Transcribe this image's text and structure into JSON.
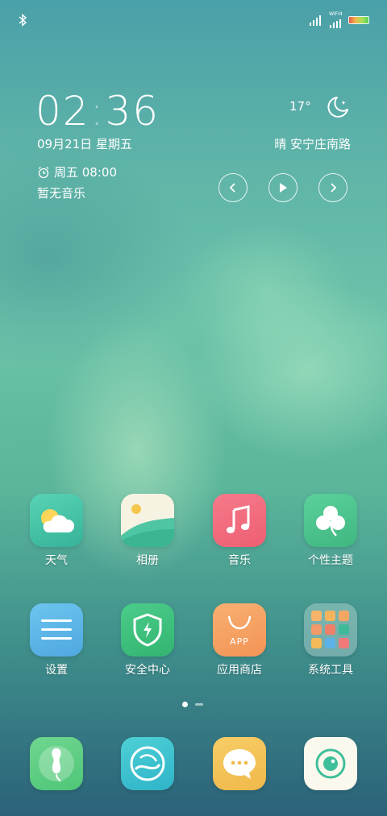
{
  "status_bar": {
    "icons": [
      "bluetooth-icon",
      "signal-icon",
      "wifi-icon",
      "battery-icon"
    ],
    "wifi_label": "WIFI4"
  },
  "clock": {
    "hour": "02",
    "separator": ":",
    "minute": "36"
  },
  "date_text": "09月21日  星期五",
  "alarm_text": "周五 08:00",
  "music_text": "暂无音乐",
  "weather": {
    "temperature": "17°",
    "condition_location": "晴 安宁庄南路",
    "icon": "moon-icon"
  },
  "media_controls": {
    "icons": [
      "prev-icon",
      "play-icon",
      "next-icon"
    ]
  },
  "apps_row1": [
    {
      "label": "天气",
      "icon": "weather-app-icon"
    },
    {
      "label": "相册",
      "icon": "gallery-app-icon"
    },
    {
      "label": "音乐",
      "icon": "music-app-icon"
    },
    {
      "label": "个性主题",
      "icon": "themes-app-icon"
    }
  ],
  "apps_row2": [
    {
      "label": "设置",
      "icon": "settings-app-icon"
    },
    {
      "label": "安全中心",
      "icon": "security-app-icon"
    },
    {
      "label": "应用商店",
      "icon": "app-store-icon"
    },
    {
      "label": "系统工具",
      "icon": "system-tools-folder-icon"
    }
  ],
  "app_store_icon_text": "APP",
  "page_indicator": {
    "pages": 2,
    "active": 1
  },
  "dock": [
    {
      "icon": "phone-app-icon"
    },
    {
      "icon": "browser-app-icon"
    },
    {
      "icon": "messages-app-icon"
    },
    {
      "icon": "camera-app-icon"
    }
  ],
  "colors": {
    "weather": "#4fc9a9",
    "gallery": "#f7f3e3",
    "music": "#f2677a",
    "themes": "#4ec48e",
    "settings": "#5db6e6",
    "security": "#3ec27e",
    "app_store": "#f6a363",
    "folder": "rgba(255,255,255,0.28)",
    "phone": "#5fcf83",
    "browser": "#3ec3cf",
    "messages": "#f4c25a",
    "camera": "#fbf9ee"
  }
}
